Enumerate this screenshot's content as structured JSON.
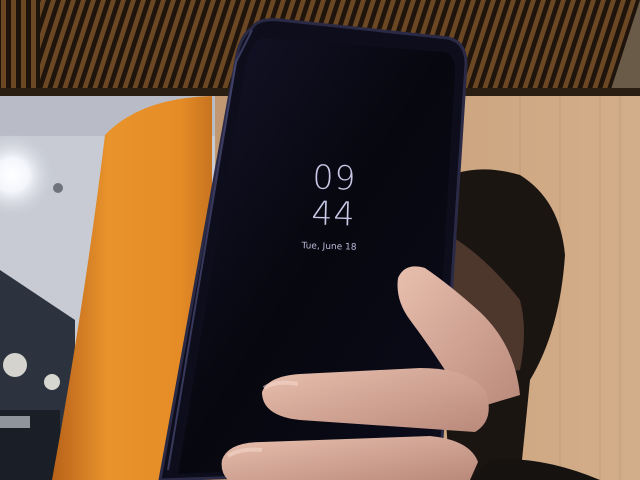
{
  "lockscreen": {
    "hour": "09",
    "minute": "44",
    "date": "Tue, June 18"
  },
  "colors": {
    "ceiling_slat": "#5a3a1c",
    "orange_pillar": "#e08a2a",
    "wood_wall": "#c9a27c",
    "phone_screen": "#0a0a18",
    "clock_text": "#c9c8e6"
  }
}
